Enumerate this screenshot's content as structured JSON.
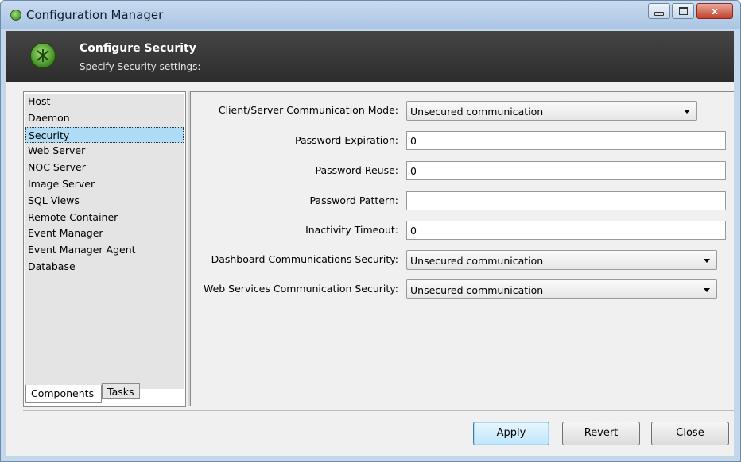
{
  "window": {
    "title": "Configuration Manager",
    "controls": {
      "close_glyph": "x"
    }
  },
  "header": {
    "title": "Configure Security",
    "subtitle": "Specify Security settings:"
  },
  "sidebar": {
    "items": [
      {
        "label": "Host"
      },
      {
        "label": "Daemon"
      },
      {
        "label": "Security",
        "selected": true
      },
      {
        "label": "Web Server"
      },
      {
        "label": "NOC Server"
      },
      {
        "label": "Image Server"
      },
      {
        "label": "SQL Views"
      },
      {
        "label": "Remote Container"
      },
      {
        "label": "Event Manager"
      },
      {
        "label": "Event Manager Agent"
      },
      {
        "label": "Database"
      }
    ],
    "tabs": [
      {
        "label": "Components",
        "active": true
      },
      {
        "label": "Tasks",
        "active": false
      }
    ]
  },
  "form": {
    "client_server_mode": {
      "label": "Client/Server Communication Mode:",
      "value": "Unsecured communication"
    },
    "password_expiration": {
      "label": "Password Expiration:",
      "value": "0"
    },
    "password_reuse": {
      "label": "Password Reuse:",
      "value": "0"
    },
    "password_pattern": {
      "label": "Password Pattern:",
      "value": ""
    },
    "inactivity_timeout": {
      "label": "Inactivity Timeout:",
      "value": "0"
    },
    "dashboard_security": {
      "label": "Dashboard Communications Security:",
      "value": "Unsecured communication"
    },
    "web_services_security": {
      "label": "Web Services Communication Security:",
      "value": "Unsecured communication"
    }
  },
  "buttons": {
    "apply": "Apply",
    "revert": "Revert",
    "close": "Close"
  },
  "colors": {
    "selection": "#aedcf7",
    "header_bg": "#383838",
    "accent": "#3c7fb1"
  }
}
